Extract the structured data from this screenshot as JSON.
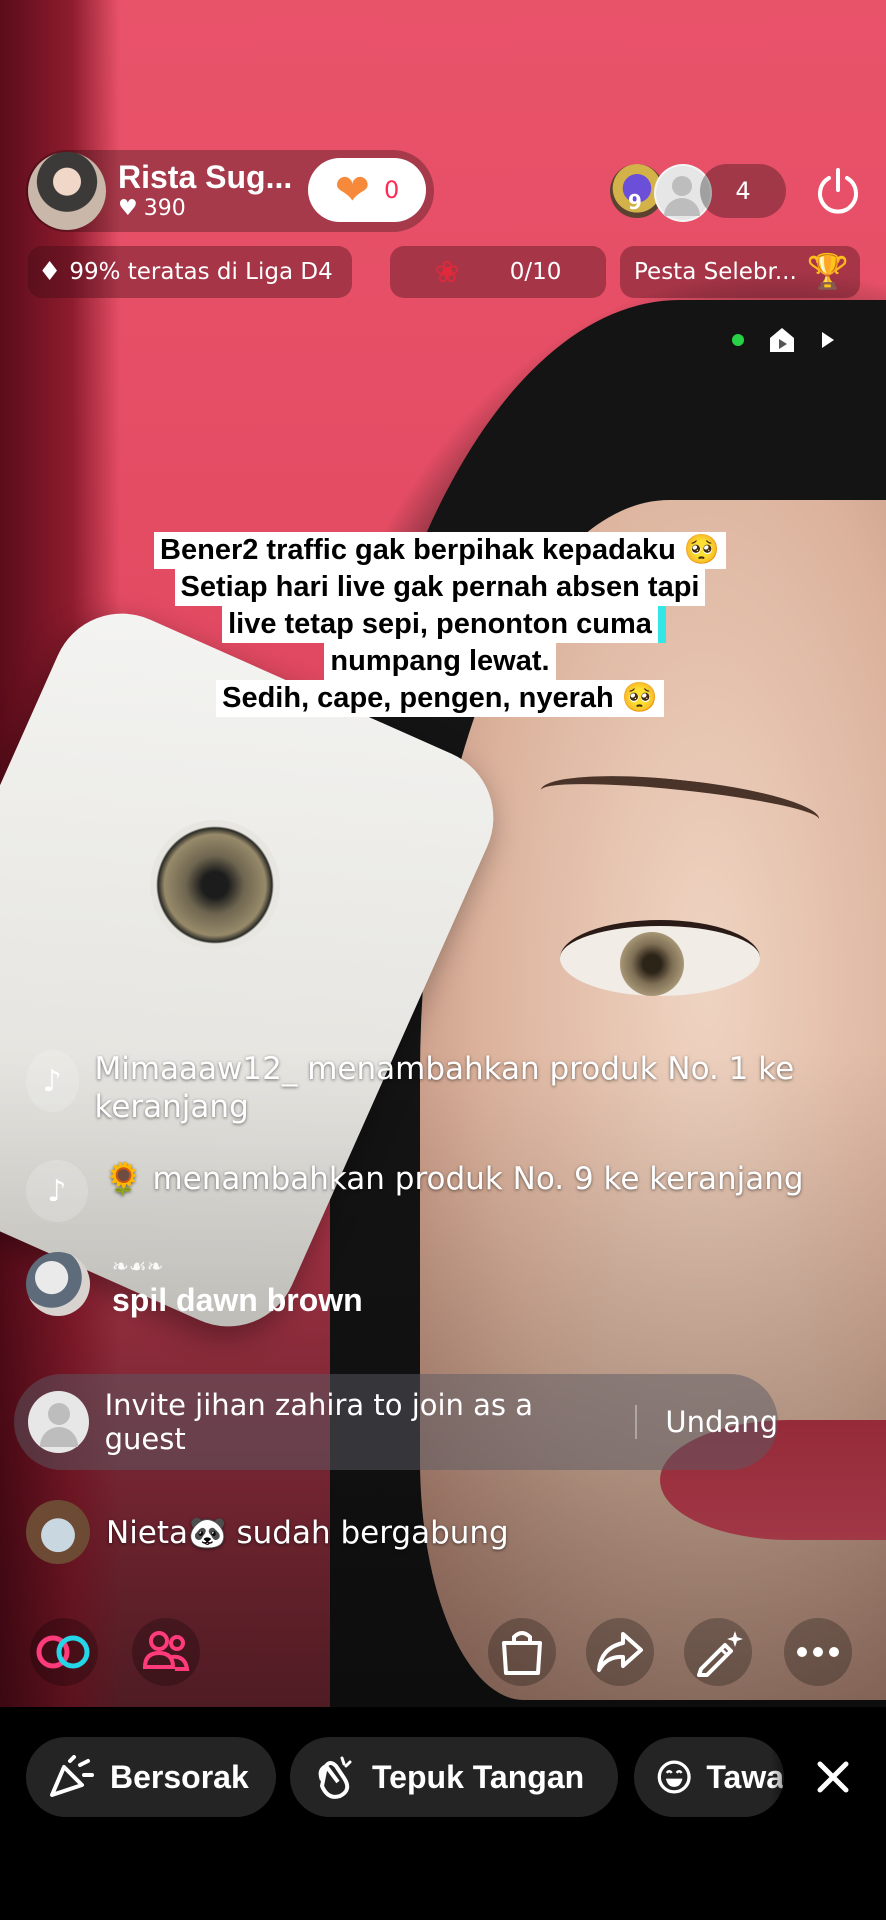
{
  "host": {
    "name": "Rista Sug...",
    "likes": "390",
    "follow_count": "0"
  },
  "viewers": {
    "badge_level": "9",
    "count": "4"
  },
  "chips": {
    "rank": "99% teratas di Liga D4",
    "rose_progress": "0/10",
    "party": "Pesta Selebr..."
  },
  "caption": {
    "lines": [
      "Bener2 traffic gak berpihak kepadaku 🥺",
      "Setiap hari live gak pernah absen tapi",
      "live tetap sepi, penonton cuma",
      "numpang lewat.",
      "Sedih, cape, pengen, nyerah 🥺"
    ]
  },
  "feed": {
    "item1": "Mimaaaw12_ menambahkan produk No. 1 ke keranjang",
    "item2": "🌻 menambahkan produk No. 9 ke keranjang",
    "comment_user": "❧☙❧",
    "comment_text": "spil dawn brown"
  },
  "invite": {
    "text": "Invite jihan zahira to join as a guest",
    "button": "Undang"
  },
  "join": {
    "text": "Nieta🐼 sudah bergabung"
  },
  "reactions": [
    {
      "label": "Bersorak",
      "icon": "cheer-icon"
    },
    {
      "label": "Tepuk Tangan",
      "icon": "clap-icon"
    },
    {
      "label": "Tawa",
      "icon": "laugh-icon"
    }
  ],
  "colors": {
    "accent": "#fe2c55",
    "follow_heart": "#f7893a",
    "live_dot": "#27d247"
  }
}
